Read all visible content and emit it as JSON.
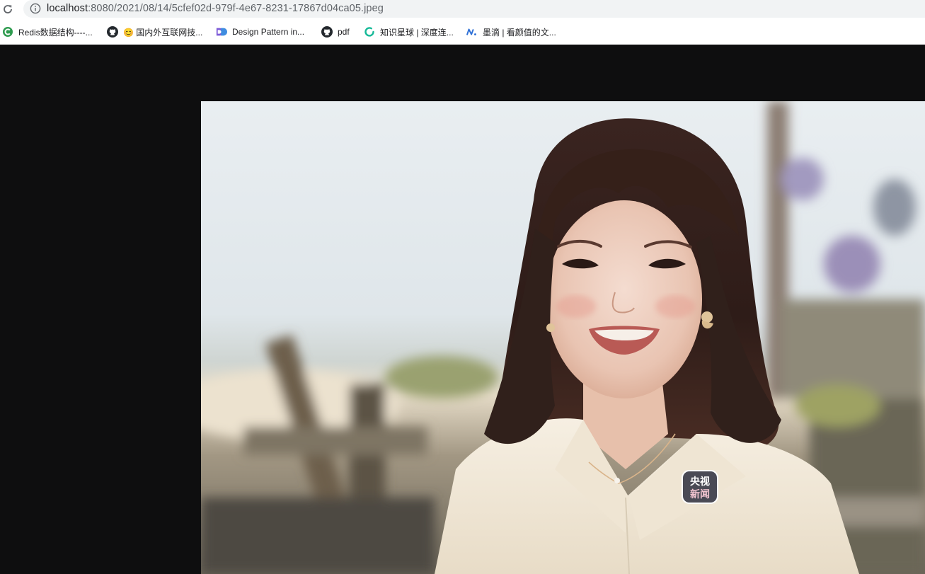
{
  "address_bar": {
    "url_host": "localhost",
    "url_path": ":8080/2021/08/14/5cfef02d-979f-4e67-8231-17867d04ca05.jpeg"
  },
  "bookmarks": [
    {
      "label": "Redis数据结构----...",
      "icon": "c-logo-icon",
      "color": "#2e9b4f"
    },
    {
      "label": "😊 国内外互联网技...",
      "icon": "github-icon",
      "color": "#24292e"
    },
    {
      "label": "Design Pattern in...",
      "icon": "refactoring-guru-icon",
      "color": "#5b4dd6"
    },
    {
      "label": "pdf",
      "icon": "github-icon",
      "color": "#24292e"
    },
    {
      "label": "知识星球 | 深度连...",
      "icon": "zsxq-icon",
      "color": "#16b998"
    },
    {
      "label": "墨滴 | 看颜值的文...",
      "icon": "mdnice-icon",
      "color": "#2d6fd6"
    }
  ],
  "image": {
    "badge_line1": "央视",
    "badge_line2": "新闻",
    "background_color": "#0e0e0f"
  }
}
